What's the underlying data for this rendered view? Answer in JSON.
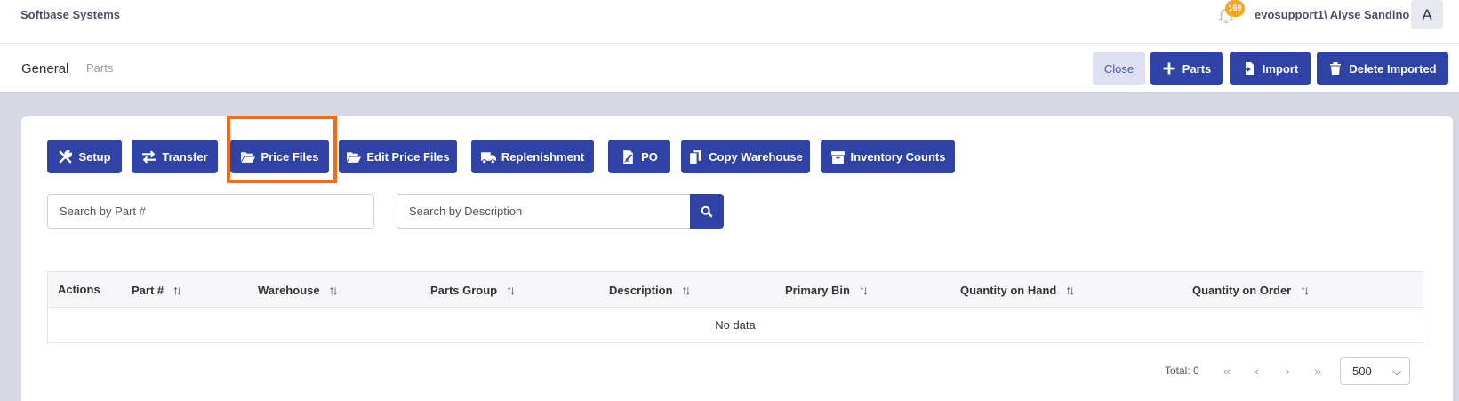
{
  "topbar": {
    "app_title": "Softbase Systems",
    "notification_count": "169",
    "user_name": "evosupport1\\ Alyse Sandino",
    "avatar_initial": "A"
  },
  "breadcrumb": {
    "section": "General",
    "page": "Parts"
  },
  "header_actions": {
    "close_label": "Close",
    "parts_label": "Parts",
    "import_label": "Import",
    "delete_imported_label": "Delete Imported"
  },
  "toolbar": {
    "setup_label": "Setup",
    "transfer_label": "Transfer",
    "price_files_label": "Price Files",
    "edit_price_files_label": "Edit Price Files",
    "replenishment_label": "Replenishment",
    "po_label": "PO",
    "copy_warehouse_label": "Copy Warehouse",
    "inventory_counts_label": "Inventory Counts"
  },
  "search": {
    "part_placeholder": "Search by Part #",
    "description_placeholder": "Search by Description"
  },
  "table": {
    "columns": [
      "Actions",
      "Part #",
      "Warehouse",
      "Parts Group",
      "Description",
      "Primary Bin",
      "Quantity on Hand",
      "Quantity on Order"
    ],
    "empty_text": "No data"
  },
  "pagination": {
    "total_label": "Total: 0",
    "first": "«",
    "prev": "‹",
    "next": "›",
    "last": "»",
    "page_size": "500"
  },
  "colors": {
    "primary": "#2f43a7",
    "highlight": "#f26a1b",
    "badge": "#f5a623"
  }
}
